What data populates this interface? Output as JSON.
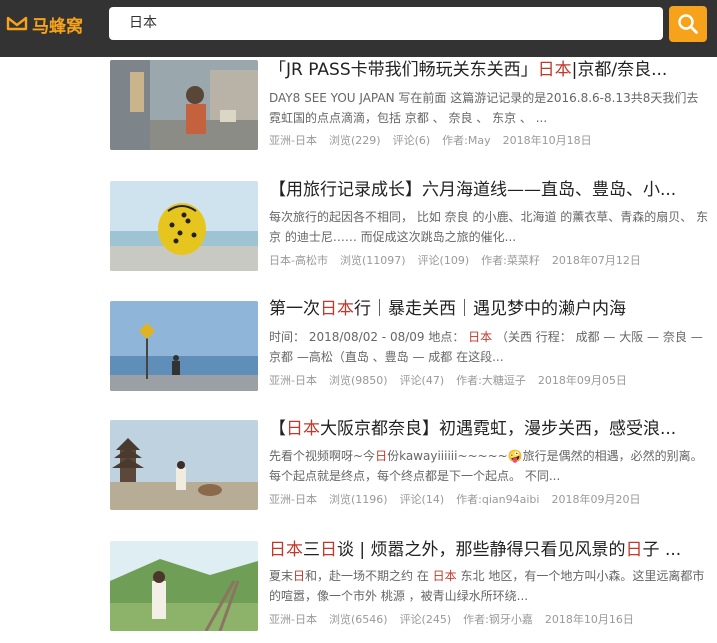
{
  "header": {
    "logo_text": "马蜂窝",
    "search_value": "日本",
    "accent": "#f7a21b"
  },
  "results": [
    {
      "title_parts": [
        "「JR PASS卡带我们畅玩关东关西」",
        "日本",
        "|京都/奈良..."
      ],
      "desc": "DAY8 SEE YOU JAPAN 写在前面 这篇游记记录的是2016.8.6-8.13共8天我们去霓虹国的点点滴滴，包括 京都 、 奈良 、 东京 、 ...",
      "location": "亚洲-日本",
      "views": "浏览(229)",
      "comments": "评论(6)",
      "author": "作者:May",
      "date": "2018年10月18日"
    },
    {
      "title_parts": [
        "【用旅行记录成长】六月海道线——直岛、豊岛、小..."
      ],
      "desc": "每次旅行的起因各不相同， 比如 奈良 的小鹿、北海道 的薰衣草、青森的扇贝、 东京 的迪士尼…… 而促成这次跳岛之旅的催化...",
      "location": "日本-高松市",
      "views": "浏览(11097)",
      "comments": "评论(109)",
      "author": "作者:菜菜籽",
      "date": "2018年07月12日"
    },
    {
      "title_parts": [
        "第一次",
        "日本",
        "行｜暴走关西｜遇见梦中的濑户内海"
      ],
      "desc_parts": [
        "时间： 2018/08/02 - 08/09 地点： ",
        "日本",
        " （关西 行程： 成都 — 大阪 — 奈良 — 京都 —高松（直岛 、豊岛 — 成都 在这段..."
      ],
      "location": "亚洲-日本",
      "views": "浏览(9850)",
      "comments": "评论(47)",
      "author": "作者:大糖逗子",
      "date": "2018年09月05日"
    },
    {
      "title_parts": [
        "【",
        "日本",
        "大阪京都奈良】初遇霓虹，漫步关西，感受浪..."
      ],
      "desc_parts": [
        "先看个视频啊呀~今",
        "日",
        "份kawayiiiiii~~~~~🤪旅行是偶然的相遇，必然的别离。每个起点就是终点，每个终点都是下一个起点。 不同..."
      ],
      "location": "亚洲-日本",
      "views": "浏览(1196)",
      "comments": "评论(14)",
      "author": "作者:qian94aibi",
      "date": "2018年09月20日"
    },
    {
      "title_parts": [
        "日本",
        "三",
        "日",
        "谈 | 烦嚣之外，那些静得只看见风景的",
        "日",
        "子 ..."
      ],
      "desc_parts": [
        "夏末",
        "日",
        "和，赴一场不期之约 在 ",
        "日本",
        " 东北 地区，有一个地方叫小森。这里远离都市的喧嚣，像一个市外 桃源 ，被青山绿水所环绕..."
      ],
      "location": "亚洲-日本",
      "views": "浏览(6546)",
      "comments": "评论(245)",
      "author": "作者:钢牙小嘉",
      "date": "2018年10月16日"
    }
  ]
}
